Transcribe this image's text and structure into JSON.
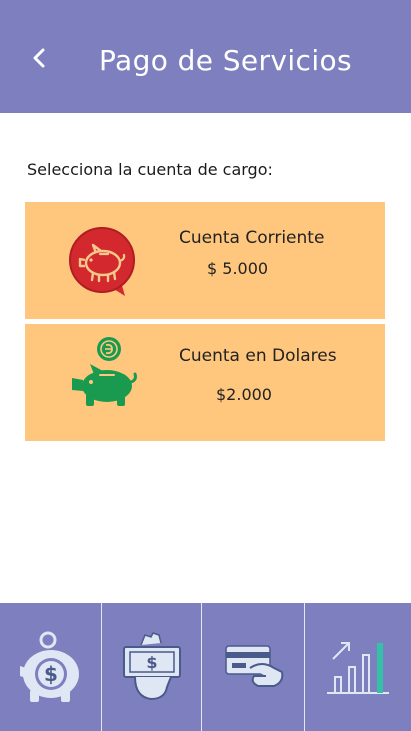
{
  "header": {
    "back_icon": "chevron-left-icon",
    "title": "Pago de Servicios",
    "background": "#7e7fbf"
  },
  "prompt": "Selecciona la cuenta de cargo:",
  "accounts": [
    {
      "name": "Cuenta Corriente",
      "amount": "$ 5.000",
      "icon": "piggy-bank-red-icon"
    },
    {
      "name": "Cuenta en Dolares",
      "amount": "$2.000",
      "icon": "piggy-bank-coin-icon"
    }
  ],
  "colors": {
    "card_background": "#fec77d",
    "nav_background": "#7e7fbf",
    "red_icon": "#d3292e",
    "green_icon": "#1a9a4e"
  },
  "bottom_nav": [
    {
      "icon": "piggy-bank-dollar-icon"
    },
    {
      "icon": "cash-hand-icon"
    },
    {
      "icon": "card-payment-icon"
    },
    {
      "icon": "bar-chart-growth-icon"
    }
  ]
}
